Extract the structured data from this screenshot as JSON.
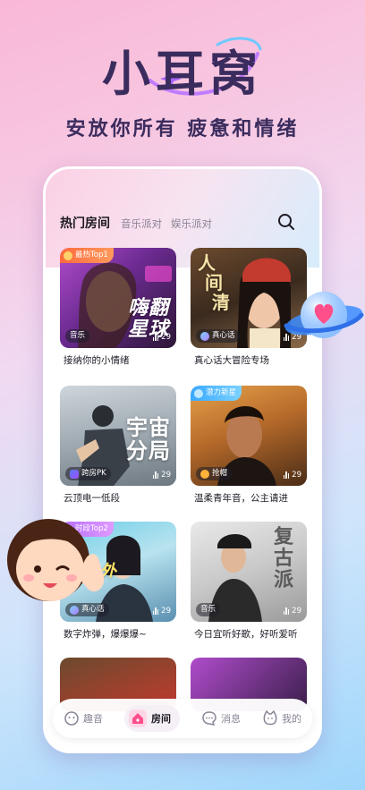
{
  "app": {
    "title": "小耳窝",
    "slogan": "安放你所有   疲惫和情绪"
  },
  "tabs": [
    {
      "label": "热门房间",
      "active": true
    },
    {
      "label": "音乐派对",
      "active": false
    },
    {
      "label": "娱乐派对",
      "active": false
    }
  ],
  "rooms": [
    {
      "title": "接纳你的小情绪",
      "badge": "最热Top1",
      "tag": "音乐",
      "listeners": "29",
      "overlay": "嗨翻\n星球"
    },
    {
      "title": "真心话大冒险专场",
      "badge": "",
      "tag": "真心话",
      "listeners": "29",
      "overlay": "人\n间\n清"
    },
    {
      "title": "云顶电一低段",
      "badge": "",
      "tag": "跨房PK",
      "listeners": "29",
      "overlay": "宇宙\n分局"
    },
    {
      "title": "温柔青年音，公主请进",
      "badge": "潜力新星",
      "tag": "抢帽",
      "listeners": "29",
      "overlay": ""
    },
    {
      "title": "数字炸弹，爆爆爆~",
      "badge": "时段Top2",
      "tag": "真心话",
      "listeners": "29",
      "overlay": "之外"
    },
    {
      "title": "今日宜听好歌，好听爱听",
      "badge": "",
      "tag": "音乐",
      "listeners": "29",
      "overlay": "复\n古\n派"
    }
  ],
  "bottom_nav": [
    {
      "label": "趣音",
      "icon": "smile-face-icon",
      "active": false
    },
    {
      "label": "房间",
      "icon": "house-icon",
      "active": true
    },
    {
      "label": "消息",
      "icon": "chat-bubble-icon",
      "active": false
    },
    {
      "label": "我的",
      "icon": "cat-face-icon",
      "active": false
    }
  ],
  "colors": {
    "primary_text": "#3b2c5e",
    "badge_hot": "#ff7a3d",
    "badge_new": "#4fb5ff",
    "badge_top2": "#b676ff"
  }
}
